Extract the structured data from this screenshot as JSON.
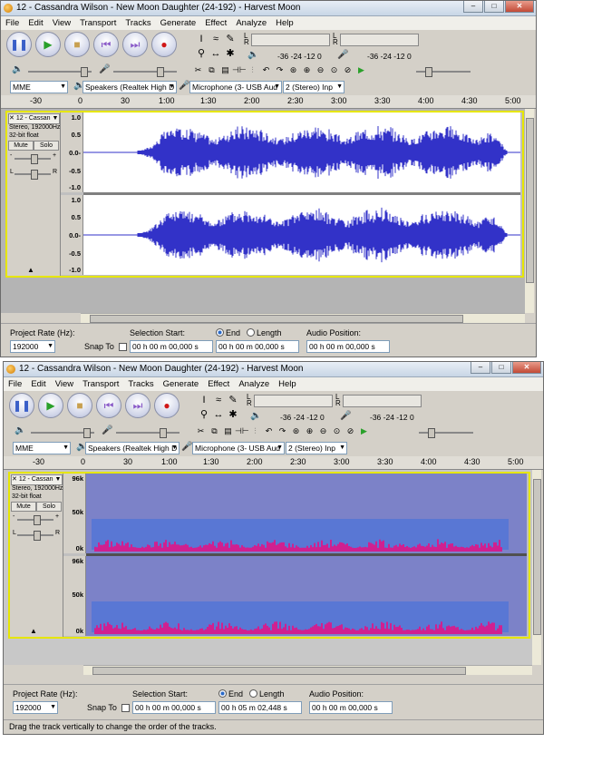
{
  "window_title": "12 - Cassandra Wilson - New Moon Daughter (24-192) - Harvest Moon",
  "window_controls": {
    "minimize": "–",
    "maximize": "□",
    "close": "✕"
  },
  "menu": [
    "File",
    "Edit",
    "View",
    "Transport",
    "Tracks",
    "Generate",
    "Effect",
    "Analyze",
    "Help"
  ],
  "transport_buttons": [
    {
      "name": "pause",
      "glyph": "❚❚",
      "color": "#3a5fc8"
    },
    {
      "name": "play",
      "glyph": "▶",
      "color": "#2aa02a"
    },
    {
      "name": "stop",
      "glyph": "■",
      "color": "#c8a050"
    },
    {
      "name": "skip-start",
      "glyph": "⏮",
      "color": "#8a5ac8"
    },
    {
      "name": "skip-end",
      "glyph": "⏭",
      "color": "#8a5ac8"
    },
    {
      "name": "record",
      "glyph": "●",
      "color": "#d01818"
    }
  ],
  "tools": [
    "I",
    "≈",
    "✎",
    "⚲",
    "↔",
    "✱"
  ],
  "meter": {
    "left": "L",
    "right": "R",
    "scale": "-36  -24  -12  0"
  },
  "edit_tools": [
    "✂",
    "⧉",
    "▤",
    "⊣⊢",
    "↶",
    "↷",
    "⊛",
    "⊕",
    "⊖",
    "⊙",
    "⊘",
    "▶"
  ],
  "device_toolbar": {
    "host": "MME",
    "output": "Speakers (Realtek High D",
    "input": "Microphone (3- USB Aud",
    "channels": "2 (Stereo) Inp"
  },
  "ruler_labels": [
    "-30",
    "0",
    "30",
    "1:00",
    "1:30",
    "2:00",
    "2:30",
    "3:00",
    "3:30",
    "4:00",
    "4:30",
    "5:00"
  ],
  "track": {
    "name": "12 - Cassan",
    "info_line1": "Stereo, 192000Hz",
    "info_line2": "32-bit float",
    "mute": "Mute",
    "solo": "Solo",
    "gain_minus": "-",
    "gain_plus": "+",
    "pan_left": "L",
    "pan_right": "R"
  },
  "waveform_scale": [
    "1.0",
    "0.5",
    "0.0-",
    "-0.5",
    "-1.0"
  ],
  "spectrogram_scale": [
    "96k",
    "50k",
    "0k"
  ],
  "spectrogram_colors": {
    "background": "#7c82c8",
    "mid": "#4a72d8",
    "hot": "#d02090"
  },
  "waveform_color": "#3232c8",
  "selection_toolbar_top": {
    "project_rate_label": "Project Rate (Hz):",
    "project_rate": "192000",
    "snap_to": "Snap To",
    "selection_start_label": "Selection Start:",
    "end_label": "End",
    "length_label": "Length",
    "audio_position_label": "Audio Position:",
    "start_value": "00 h 00 m 00,000 s",
    "end_value": "00 h 00 m 00,000 s",
    "position_value": "00 h 00 m 00,000 s"
  },
  "selection_toolbar_bottom": {
    "project_rate_label": "Project Rate (Hz):",
    "project_rate": "192000",
    "snap_to": "Snap To",
    "selection_start_label": "Selection Start:",
    "end_label": "End",
    "length_label": "Length",
    "audio_position_label": "Audio Position:",
    "start_value": "00 h 00 m 00,000 s",
    "end_value": "00 h 05 m 02,448 s",
    "position_value": "00 h 00 m 00,000 s"
  },
  "status_text": "Drag the track vertically to change the order of the tracks."
}
